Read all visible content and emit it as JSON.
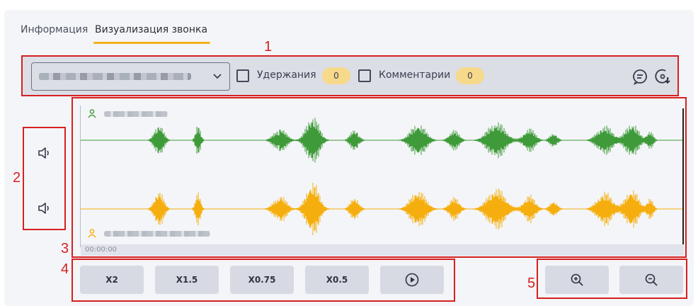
{
  "tabs": [
    {
      "label": "Информация",
      "active": false
    },
    {
      "label": "Визуализация звонка",
      "active": true
    }
  ],
  "toolbar": {
    "file_select_value": "",
    "holds": {
      "label": "Удержания",
      "count": "0",
      "checked": false
    },
    "comments": {
      "label": "Комментарии",
      "count": "0",
      "checked": false
    },
    "icons": [
      "comment-icon",
      "download-icon"
    ]
  },
  "annotations": [
    "1",
    "2",
    "3",
    "4",
    "5"
  ],
  "waveform": {
    "timecode": "00:00:00",
    "speakers": [
      {
        "channel": "top",
        "color": "#3f9b3a"
      },
      {
        "channel": "bottom",
        "color": "#f5ae0d"
      }
    ]
  },
  "speed": {
    "buttons": [
      "X2",
      "X1.5",
      "X0.75",
      "X0.5"
    ],
    "play_icon": "play-icon"
  },
  "zoom": {
    "buttons": [
      "zoom-in-icon",
      "zoom-out-icon"
    ]
  },
  "colors": {
    "accent": "#f2b21c",
    "annotation": "#d62020",
    "channel_1": "#3f9b3a",
    "channel_2": "#f5ae0d"
  }
}
